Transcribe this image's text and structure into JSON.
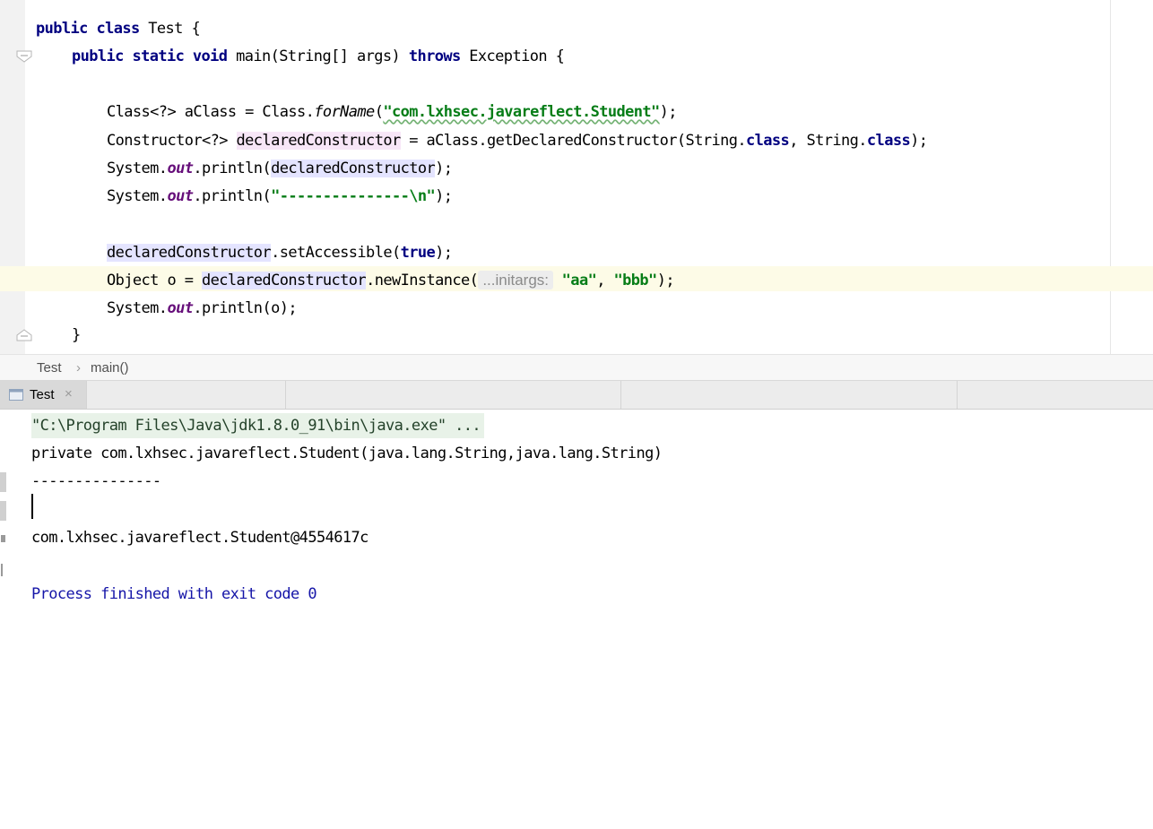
{
  "editor": {
    "line1": {
      "kw1": "public",
      "kw2": "class",
      "name": "Test",
      "brace": "{"
    },
    "line2": {
      "kw1": "public",
      "kw2": "static",
      "kw3": "void",
      "sig": "main(String[] args)",
      "throws": "throws",
      "rest": "Exception {"
    },
    "line3": {
      "pre": "Class<?> aClass = Class.",
      "method": "forName",
      "open": "(",
      "str": "\"com.lxhsec.javareflect.Student\"",
      "close": ");"
    },
    "line4": {
      "pre": "Constructor<?> ",
      "var": "declaredConstructor",
      "mid": " = aClass.getDeclaredConstructor(String.",
      "kw1": "class",
      "mid2": ", String.",
      "kw2": "class",
      "end": ");"
    },
    "line5": {
      "pre": "System.",
      "field": "out",
      "mid": ".println(",
      "var": "declaredConstructor",
      "end": ");"
    },
    "line6": {
      "pre": "System.",
      "field": "out",
      "mid": ".println(",
      "str": "\"---------------\\n\"",
      "end": ");"
    },
    "line7": {
      "var": "declaredConstructor",
      "mid": ".setAccessible(",
      "kw": "true",
      "end": ");"
    },
    "line8": {
      "pre": "Object o = ",
      "var": "declaredConstructor",
      "mid": ".newInstance(",
      "hint": "...initargs:",
      "s1": "\"aa\"",
      "comma": ", ",
      "s2": "\"bbb\"",
      "end": ");"
    },
    "line9": {
      "pre": "System.",
      "field": "out",
      "end": ".println(o);"
    },
    "line10": {
      "brace": "}"
    }
  },
  "breadcrumb": {
    "file": "Test",
    "sep": "›",
    "method": "main()"
  },
  "run": {
    "tab_label": "Test",
    "close_glyph": "×",
    "console": [
      "\"C:\\Program Files\\Java\\jdk1.8.0_91\\bin\\java.exe\" ...",
      "private com.lxhsec.javareflect.Student(java.lang.String,java.lang.String)",
      "---------------",
      "",
      "com.lxhsec.javareflect.Student@4554617c",
      "",
      "Process finished with exit code 0"
    ]
  },
  "colors": {
    "keyword": "#000080",
    "string": "#067d17",
    "static_field": "#660e7a",
    "caret_row": "#fdfbe7",
    "write_highlight": "#f7e6f7",
    "read_highlight": "#e4e4ff",
    "exit_text": "#1515a8"
  }
}
